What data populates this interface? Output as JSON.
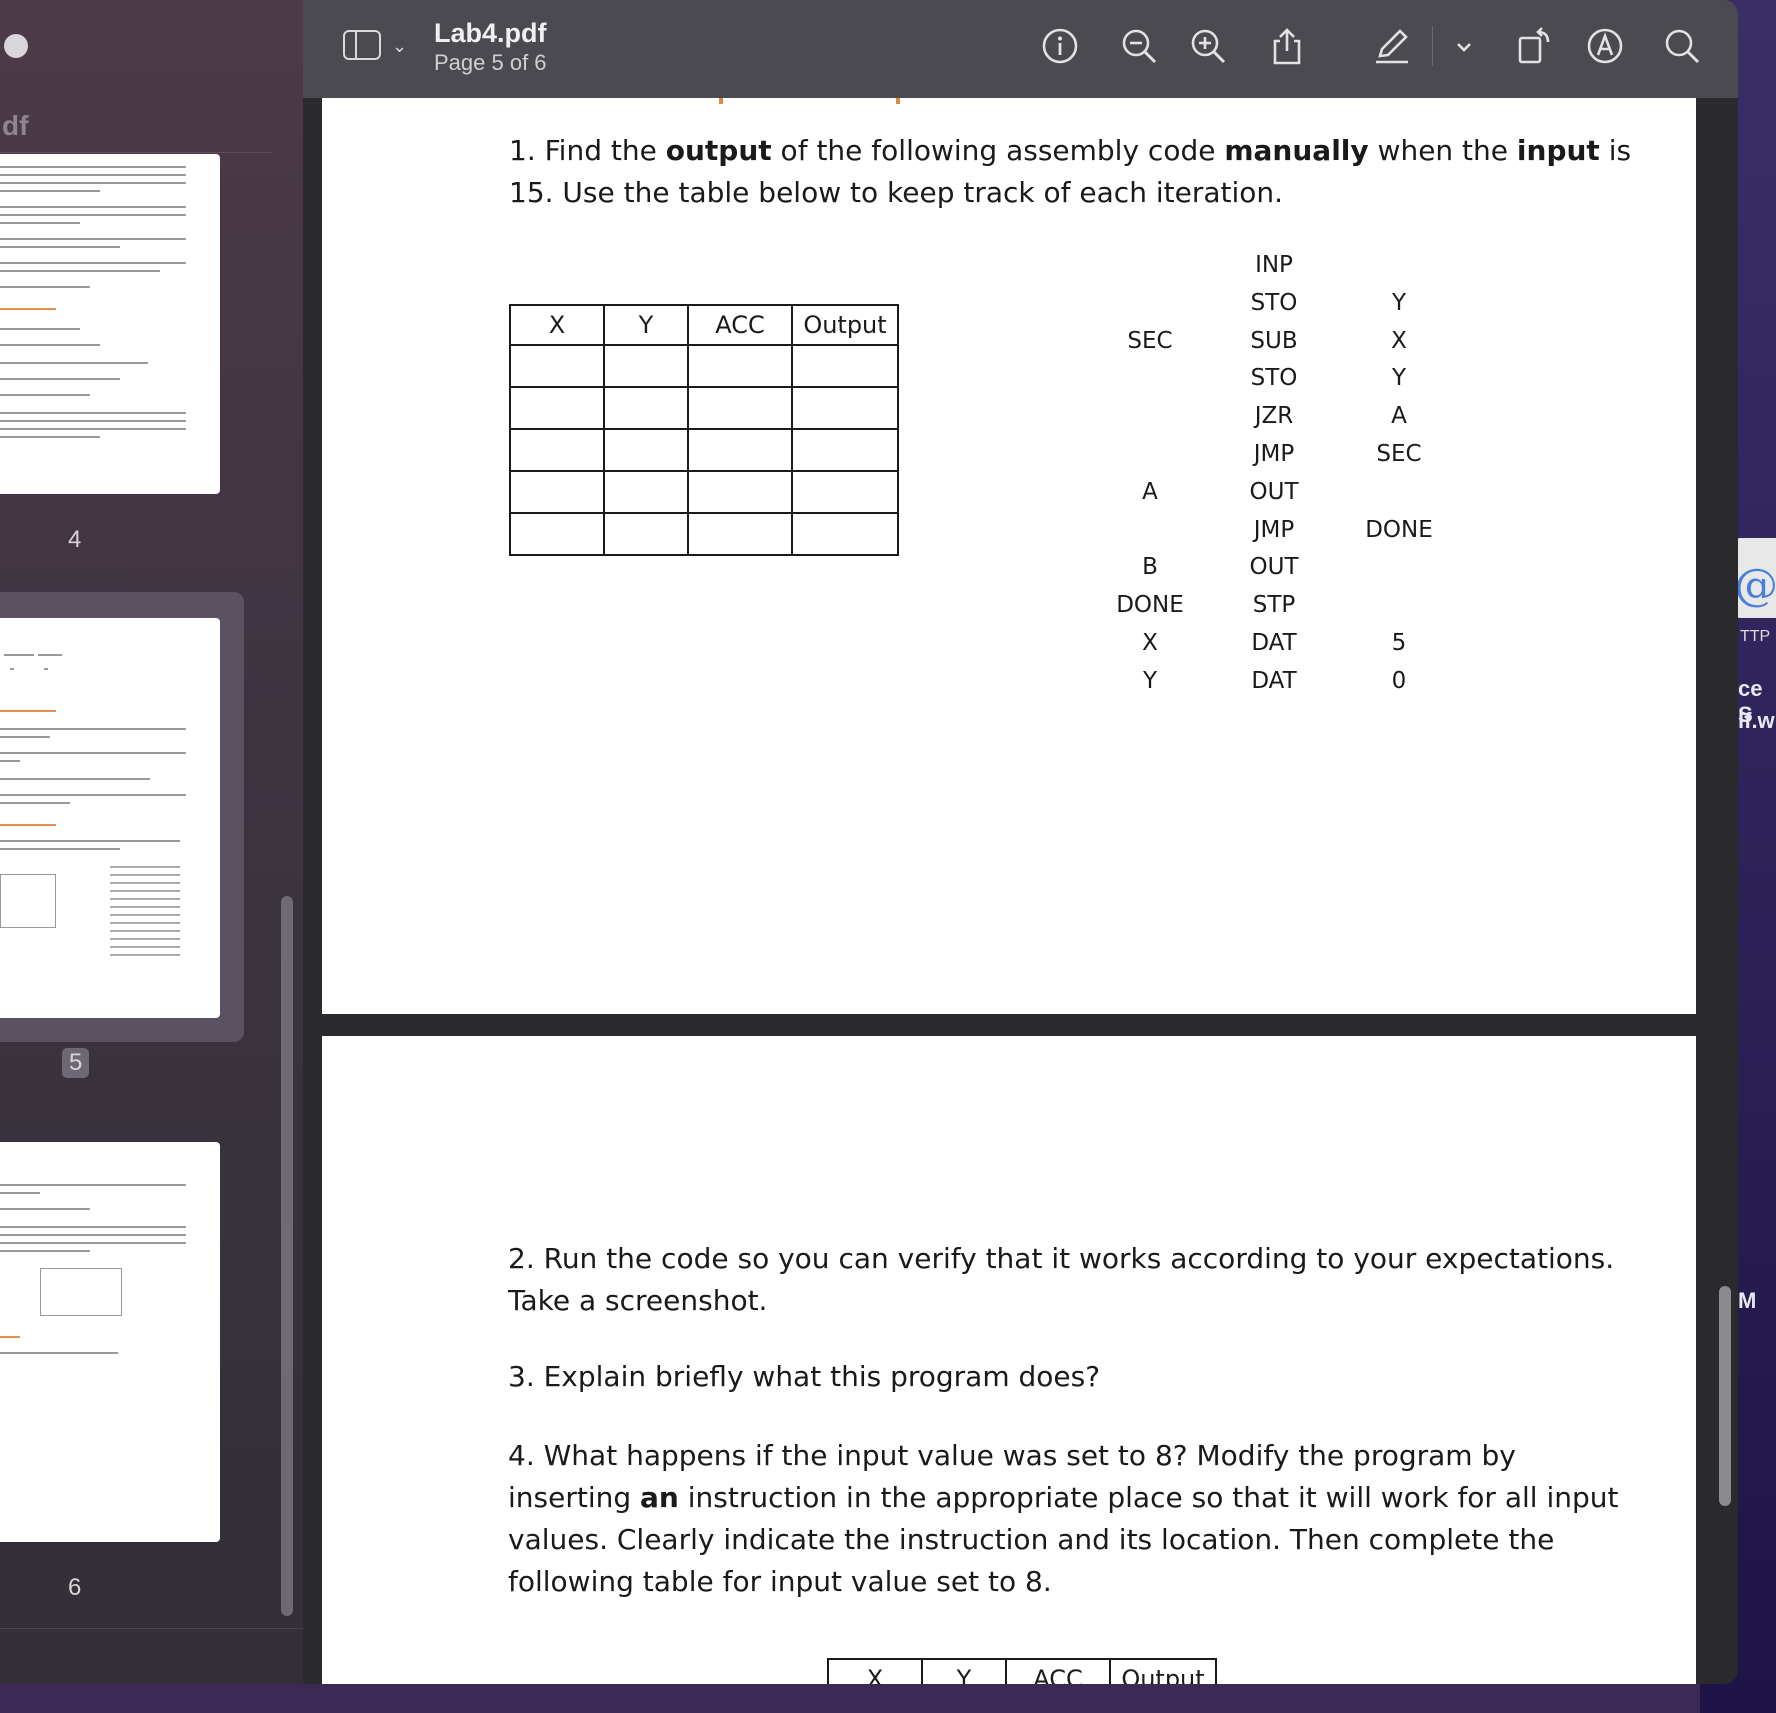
{
  "window": {
    "title": "Lab4.pdf",
    "subtitle": "Page 5 of 6"
  },
  "sidebar": {
    "title": "df",
    "page_numbers": [
      "4",
      "5",
      "6"
    ],
    "selected_page": "5"
  },
  "toolbar": {
    "icons": [
      "sidebar-toggle-icon",
      "info-icon",
      "zoom-out-icon",
      "zoom-in-icon",
      "share-icon",
      "highlight-pen-icon",
      "chevron-down-icon",
      "rotate-icon",
      "markup-icon",
      "search-icon"
    ]
  },
  "page5": {
    "q1_part1": "1. Find the ",
    "q1_b1": "output",
    "q1_part2": " of the following assembly code ",
    "q1_b2": "manually",
    "q1_part3": " when the ",
    "q1_b3": "input",
    "q1_part4": " is",
    "q1_line2": "15. Use the table below to keep track of each iteration.",
    "table_headers": [
      "X",
      "Y",
      "ACC",
      "Output"
    ],
    "code": [
      {
        "label": "",
        "op": "INP",
        "arg": ""
      },
      {
        "label": "",
        "op": "STO",
        "arg": "Y"
      },
      {
        "label": "SEC",
        "op": "SUB",
        "arg": "X"
      },
      {
        "label": "",
        "op": "STO",
        "arg": "Y"
      },
      {
        "label": "",
        "op": "JZR",
        "arg": "A"
      },
      {
        "label": "",
        "op": "JMP",
        "arg": "SEC"
      },
      {
        "label": "A",
        "op": "OUT",
        "arg": ""
      },
      {
        "label": "",
        "op": "JMP",
        "arg": "DONE"
      },
      {
        "label": "B",
        "op": "OUT",
        "arg": ""
      },
      {
        "label": "DONE",
        "op": "STP",
        "arg": ""
      },
      {
        "label": "X",
        "op": "DAT",
        "arg": "5"
      },
      {
        "label": "Y",
        "op": "DAT",
        "arg": "0"
      }
    ]
  },
  "page6": {
    "q2_line1": "2. Run the code so you can verify that it works according to your expectations.",
    "q2_line2": "Take a screenshot.",
    "q3": "3. Explain briefly what this program does?",
    "q4_line1": "4. What happens if the input value was set to 8? Modify the program by",
    "q4_line2a": "inserting ",
    "q4_line2b": "an",
    "q4_line2c": " instruction in the appropriate place so that it will work for all input",
    "q4_line3": "values. Clearly indicate the instruction and its location. Then complete the",
    "q4_line4": "following table for input value set to 8.",
    "table_headers": [
      "X",
      "Y",
      "ACC",
      "Output"
    ]
  },
  "desktop": {
    "icon_label": "TTP",
    "label1": "ce S",
    "label2": "lf.w",
    "label3": "M"
  },
  "colors": {
    "toolbar": "#4b4a50",
    "sidebar": "#3d3440",
    "accent_orange": "#e08a3c"
  }
}
